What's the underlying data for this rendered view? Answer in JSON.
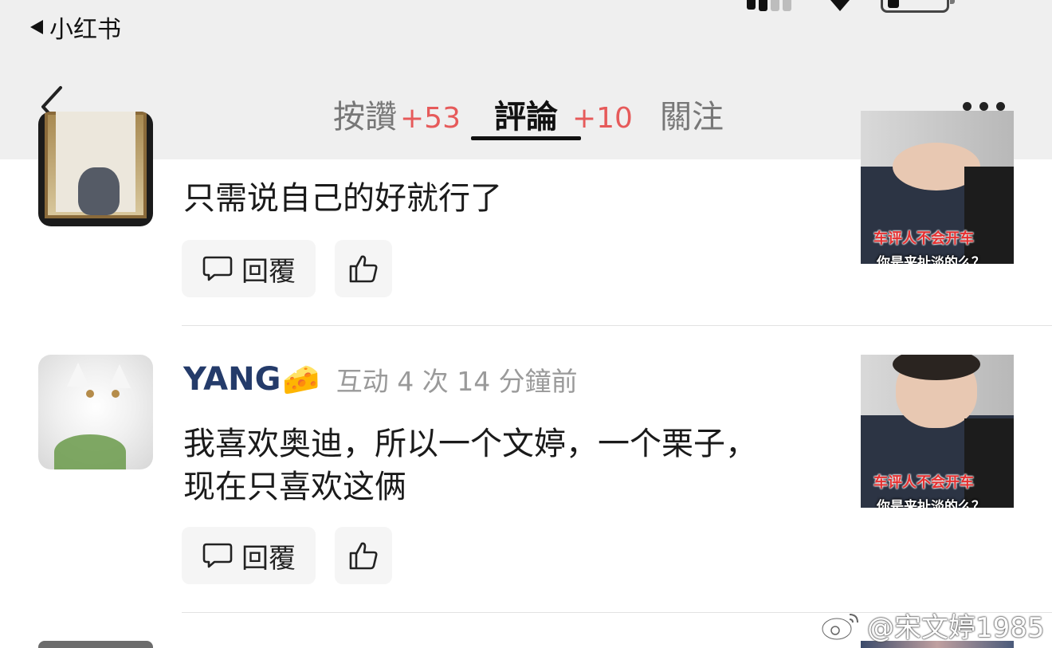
{
  "status_bar": {
    "back_app_label": "小红书",
    "icons": [
      "back-triangle-icon",
      "cellular-signal-icon",
      "wifi-icon",
      "battery-icon"
    ]
  },
  "nav": {
    "tabs": [
      {
        "label": "按讚",
        "count": "+53"
      },
      {
        "label": "評論",
        "count": "+10"
      },
      {
        "label": "關注",
        "count": ""
      }
    ],
    "active_tab": "評論",
    "icons": [
      "chevron-left-icon",
      "more-dots-icon"
    ]
  },
  "comments": [
    {
      "username": "",
      "meta": "",
      "text": "只需说自己的好就行了",
      "reply_label": "回覆",
      "thumb_caption_top": "车评人不会开车",
      "thumb_caption_bottom": "你是来扯淡的么？"
    },
    {
      "username": "YANG",
      "username_emoji": "🧀",
      "meta": "互动 4 次  14 分鐘前",
      "text": "我喜欢奥迪，所以一个文婷，一个栗子，现在只喜欢这俩",
      "reply_label": "回覆",
      "thumb_caption_top": "车评人不会开车",
      "thumb_caption_bottom": "你是来扯淡的么？"
    }
  ],
  "watermark": "@宋文婷1985",
  "colors": {
    "accent_red": "#e65a5a",
    "username_blue": "#243b6a",
    "header_bg": "#efefef"
  }
}
